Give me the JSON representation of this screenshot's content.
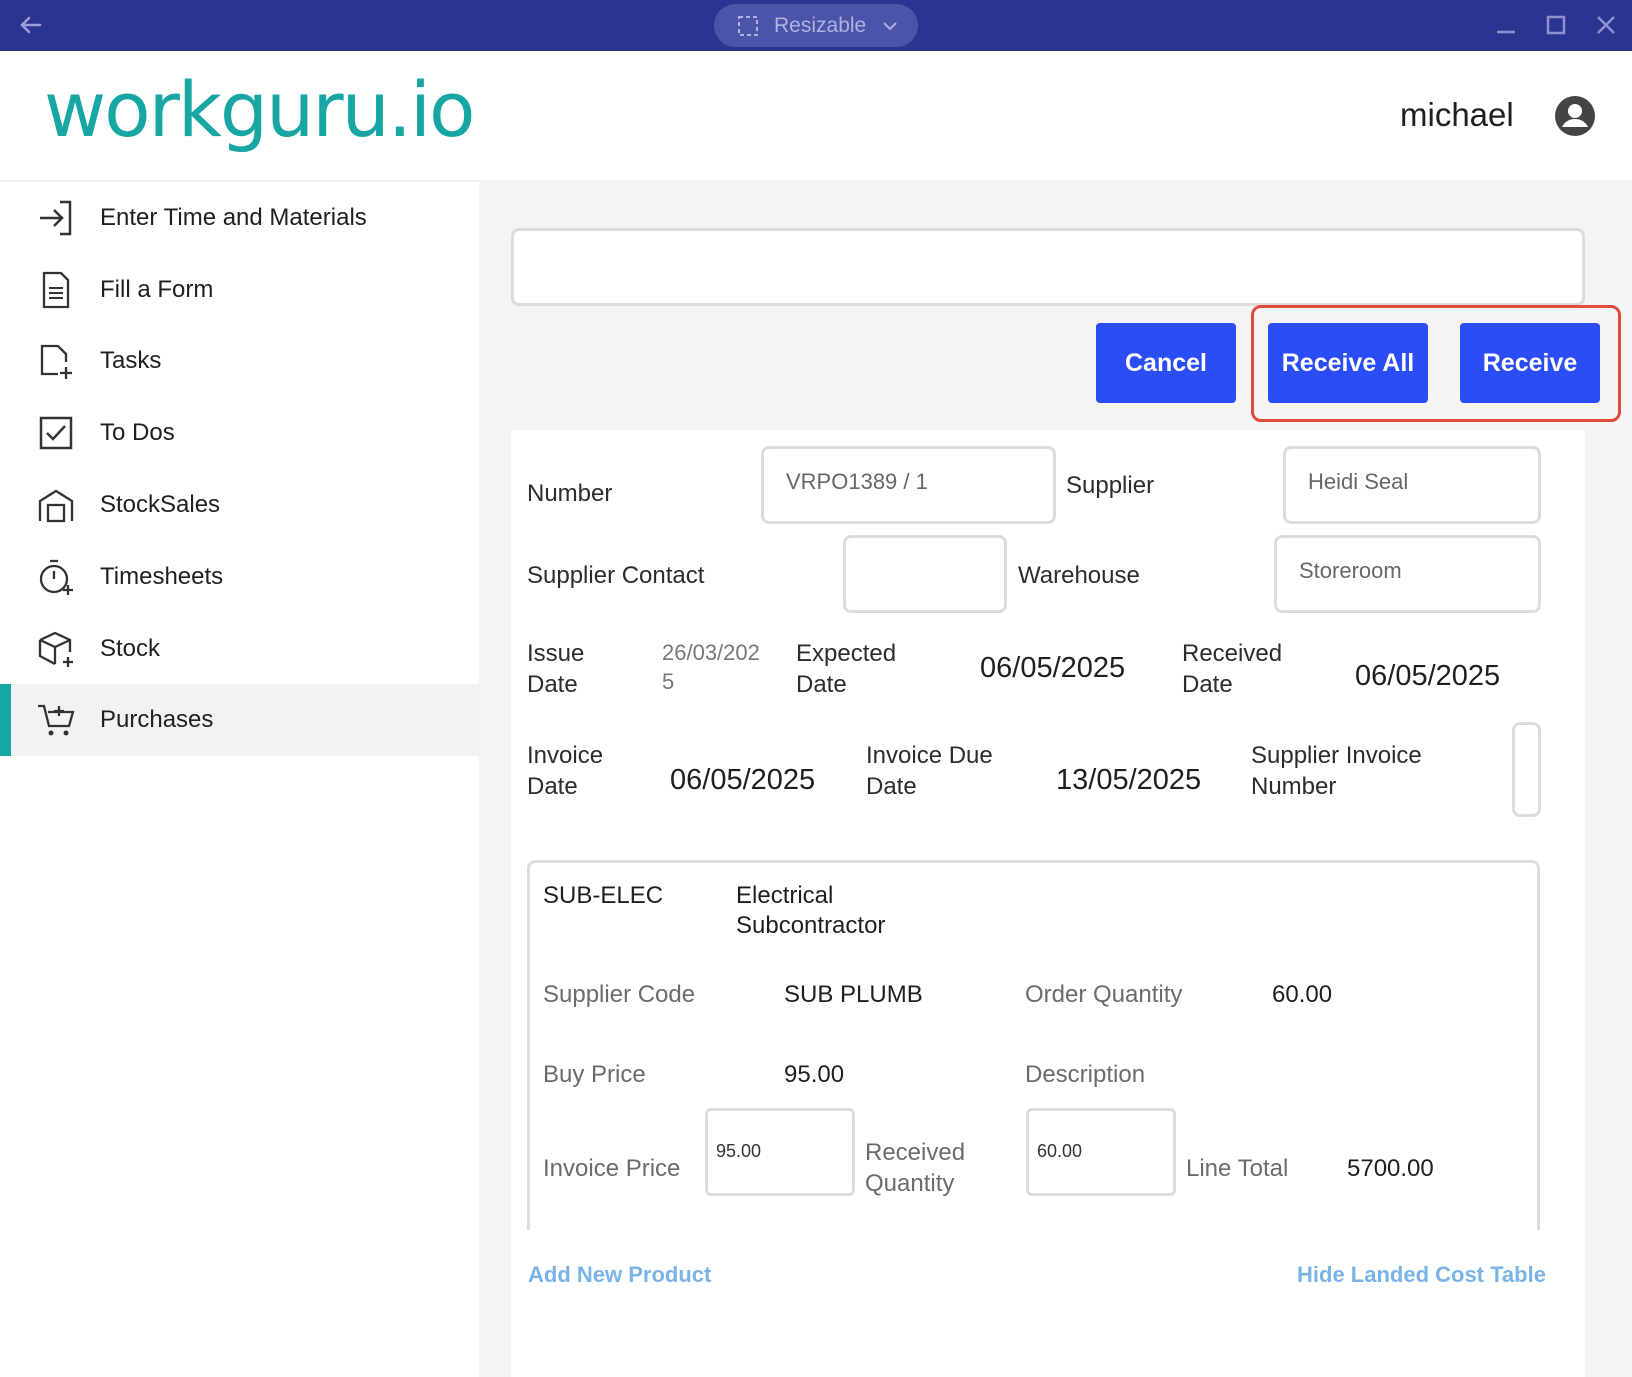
{
  "titlebar": {
    "mode_label": "Resizable"
  },
  "header": {
    "logo": "workguru.io",
    "username": "michael"
  },
  "sidebar": {
    "items": [
      {
        "label": "Enter Time and Materials",
        "icon": "login-arrow-icon"
      },
      {
        "label": "Fill a Form",
        "icon": "document-icon"
      },
      {
        "label": "Tasks",
        "icon": "task-add-icon"
      },
      {
        "label": "To Dos",
        "icon": "checkbox-icon"
      },
      {
        "label": "StockSales",
        "icon": "store-icon"
      },
      {
        "label": "Timesheets",
        "icon": "timer-add-icon"
      },
      {
        "label": "Stock",
        "icon": "box-add-icon"
      },
      {
        "label": "Purchases",
        "icon": "cart-add-icon",
        "active": true
      }
    ]
  },
  "actions": {
    "cancel": "Cancel",
    "receive_all": "Receive All",
    "receive": "Receive"
  },
  "form": {
    "number_label": "Number",
    "number_value": "VRPO1389 / 1",
    "supplier_label": "Supplier",
    "supplier_value": "Heidi Seal",
    "supplier_contact_label": "Supplier Contact",
    "supplier_contact_value": "",
    "warehouse_label": "Warehouse",
    "warehouse_value": "Storeroom",
    "issue_date_label_1": "Issue",
    "issue_date_label_2": "Date",
    "issue_date_value_1": "26/03/202",
    "issue_date_value_2": "5",
    "expected_date_label_1": "Expected",
    "expected_date_label_2": "Date",
    "expected_date_value": "06/05/2025",
    "received_date_label_1": "Received",
    "received_date_label_2": "Date",
    "received_date_value": "06/05/2025",
    "invoice_date_label_1": "Invoice",
    "invoice_date_label_2": "Date",
    "invoice_date_value": "06/05/2025",
    "invoice_due_label_1": "Invoice Due",
    "invoice_due_label_2": "Date",
    "invoice_due_value": "13/05/2025",
    "supplier_invoice_label_1": "Supplier Invoice",
    "supplier_invoice_label_2": "Number"
  },
  "product": {
    "code": "SUB-ELEC",
    "name_1": "Electrical",
    "name_2": "Subcontractor",
    "supplier_code_label": "Supplier Code",
    "supplier_code_value": "SUB PLUMB",
    "order_qty_label": "Order Quantity",
    "order_qty_value": "60.00",
    "buy_price_label": "Buy Price",
    "buy_price_value": "95.00",
    "description_label": "Description",
    "invoice_price_label": "Invoice Price",
    "invoice_price_value": "95.00",
    "received_qty_label_1": "Received",
    "received_qty_label_2": "Quantity",
    "received_qty_value": "60.00",
    "line_total_label": "Line Total",
    "line_total_value": "5700.00"
  },
  "links": {
    "add_product": "Add New Product",
    "hide_landed": "Hide Landed Cost Table"
  },
  "colors": {
    "titlebar": "#2b3590",
    "brand_teal": "#17a6a3",
    "button_blue": "#2b4df5",
    "highlight_red": "#e14b3b",
    "link_blue": "#7ab3e6"
  }
}
